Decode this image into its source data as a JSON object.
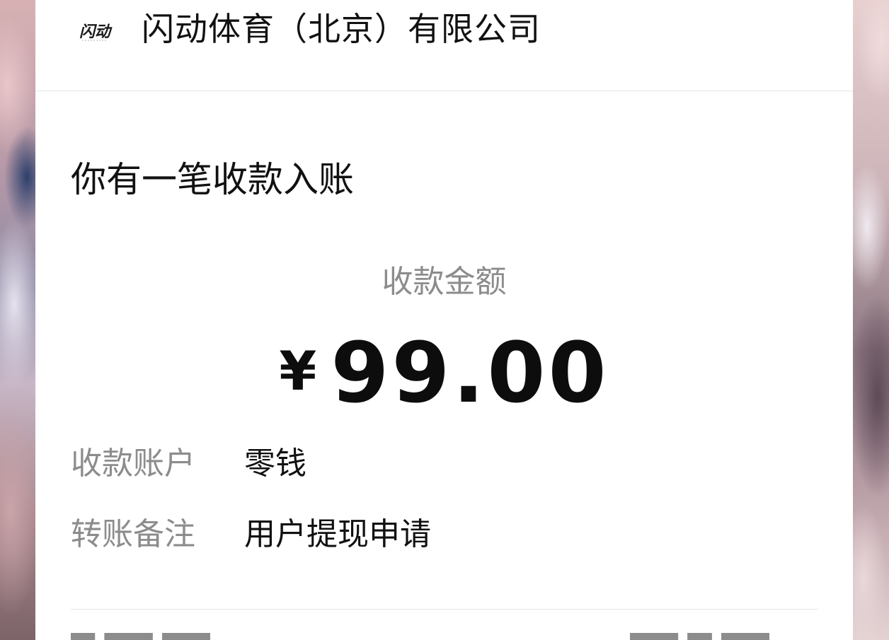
{
  "header": {
    "logo_text": "闪动",
    "company_name": "闪动体育（北京）有限公司"
  },
  "main": {
    "headline": "你有一笔收款入账",
    "amount_label": "收款金额",
    "currency_symbol": "¥",
    "amount": "99.00"
  },
  "details": [
    {
      "key": "收款账户",
      "value": "零钱"
    },
    {
      "key": "转账备注",
      "value": "用户提现申请"
    }
  ],
  "colors": {
    "primary_text": "#111111",
    "secondary_text": "#8c8c8c",
    "divider": "#e6e6e6",
    "card_background": "#ffffff"
  }
}
